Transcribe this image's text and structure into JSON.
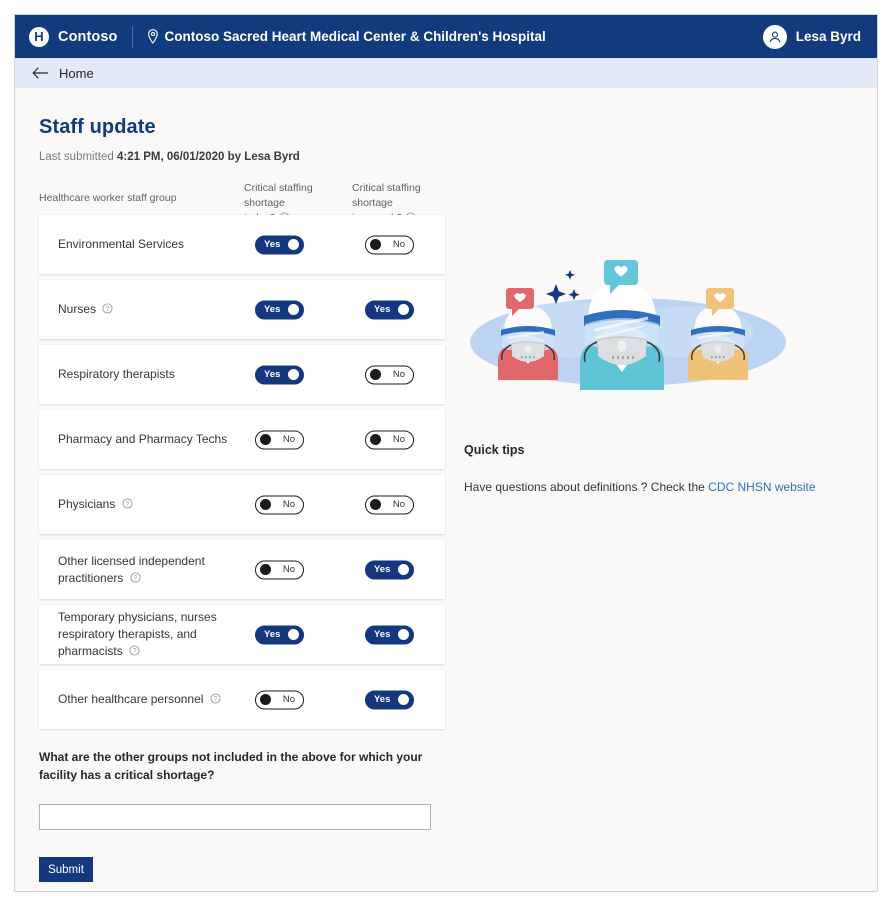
{
  "topbar": {
    "logo_letter": "H",
    "brand": "Contoso",
    "site_name": "Contoso Sacred Heart Medical Center & Children's Hospital",
    "account_name": "Lesa Byrd",
    "location_icon": "location-pin-icon",
    "avatar_icon": "person-avatar-icon"
  },
  "breadcrumb": {
    "back_icon": "back-arrow-icon",
    "label": "Home"
  },
  "page": {
    "title": "Staff update",
    "submitted_prefix": "Last submitted ",
    "submitted_value": "4:21 PM, 06/01/2020 by Lesa Byrd"
  },
  "columns": {
    "group": "Healthcare worker staff group",
    "today_line1": "Critical staffing shortage",
    "today_line2": "today?",
    "week_line1": "Critical staffing shortage",
    "week_line2": "in a week?",
    "help_icon": "help-circle-icon"
  },
  "toggle_labels": {
    "yes": "Yes",
    "no": "No"
  },
  "rows": [
    {
      "label": "Environmental Services",
      "help": false,
      "today": "Yes",
      "week": "No"
    },
    {
      "label": "Nurses",
      "help": true,
      "today": "Yes",
      "week": "Yes"
    },
    {
      "label": "Respiratory therapists",
      "help": false,
      "today": "Yes",
      "week": "No"
    },
    {
      "label": "Pharmacy and Pharmacy Techs",
      "help": false,
      "today": "No",
      "week": "No"
    },
    {
      "label": "Physicians",
      "help": true,
      "today": "No",
      "week": "No"
    },
    {
      "label": "Other licensed independent practitioners",
      "help": true,
      "today": "No",
      "week": "Yes"
    },
    {
      "label": "Temporary physicians, nurses respiratory therapists, and pharmacists",
      "help": true,
      "today": "Yes",
      "week": "Yes"
    },
    {
      "label": "Other healthcare personnel",
      "help": true,
      "today": "No",
      "week": "Yes"
    }
  ],
  "other_groups": {
    "question": "What are the other groups not included in the above for which your facility has a critical shortage?",
    "value": "",
    "placeholder": ""
  },
  "submit": {
    "label": "Submit"
  },
  "quick_tips": {
    "title": "Quick tips",
    "text_before": "Have questions about definitions ? Check the ",
    "link_text": "CDC NHSN website"
  },
  "illustration": {
    "name": "healthcare-workers-masks-illustration"
  },
  "colors": {
    "header_blue": "#123b7e",
    "accent_blue": "#14387f",
    "breadcrumb_bg": "#e4e9f7",
    "page_bg": "#faf9f8",
    "link_blue": "#2f6fc0",
    "illustration_blob": "#b9d2f0"
  }
}
